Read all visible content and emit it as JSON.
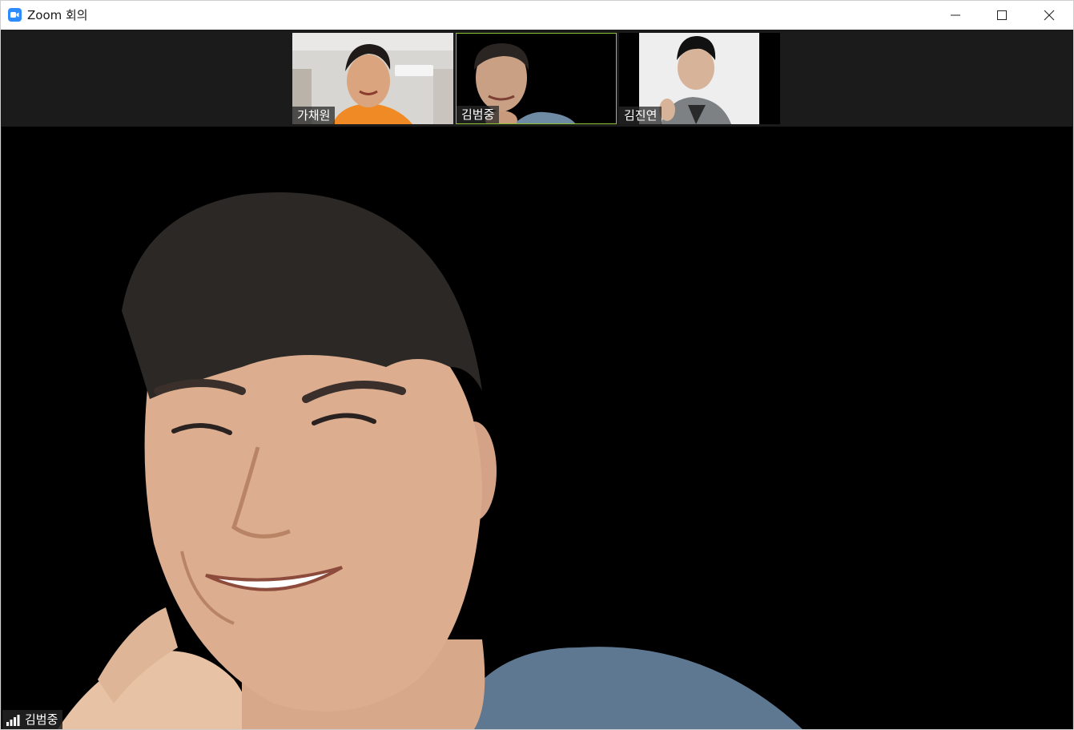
{
  "window": {
    "title": "Zoom 회의",
    "icon": "zoom-camera-icon",
    "controls": [
      "minimize-icon",
      "maximize-icon",
      "close-icon"
    ]
  },
  "participants": [
    {
      "name": "가채원",
      "active": false
    },
    {
      "name": "김범중",
      "active": true
    },
    {
      "name": "김진연",
      "active": false
    }
  ],
  "main_video": {
    "speaker_name": "김범중",
    "signal_icon": "signal-strength-icon"
  },
  "colors": {
    "active_speaker_border": "#8ac231",
    "zoom_blue": "#2d8cff",
    "strip_background": "#1b1b1b",
    "video_background": "#000000"
  }
}
